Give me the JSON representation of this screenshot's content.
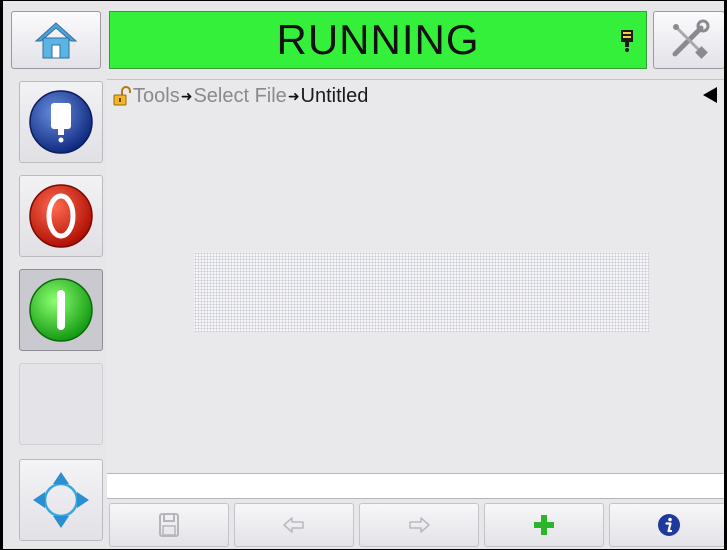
{
  "status": {
    "text": "RUNNING",
    "color": "#35f03a"
  },
  "breadcrumb": {
    "part1": "Tools",
    "part2": "Select File",
    "part3": "Untitled"
  },
  "icons": {
    "home": "home-icon",
    "tools": "tools-icon",
    "printhead": "printhead-icon",
    "jet": "ink-jet-icon",
    "stop": "stop-icon",
    "start": "start-icon",
    "nav": "navigation-arrows-icon",
    "save": "save-icon",
    "undo": "undo-icon",
    "redo": "redo-icon",
    "add": "add-icon",
    "info": "info-icon",
    "lock": "unlocked-padlock-icon",
    "back": "back-triangle-icon"
  },
  "colors": {
    "add": "#2bb52b",
    "info": "#1e3a9e",
    "stop": "#e02010",
    "start": "#2fd32f",
    "jet": "#1d47a8"
  }
}
